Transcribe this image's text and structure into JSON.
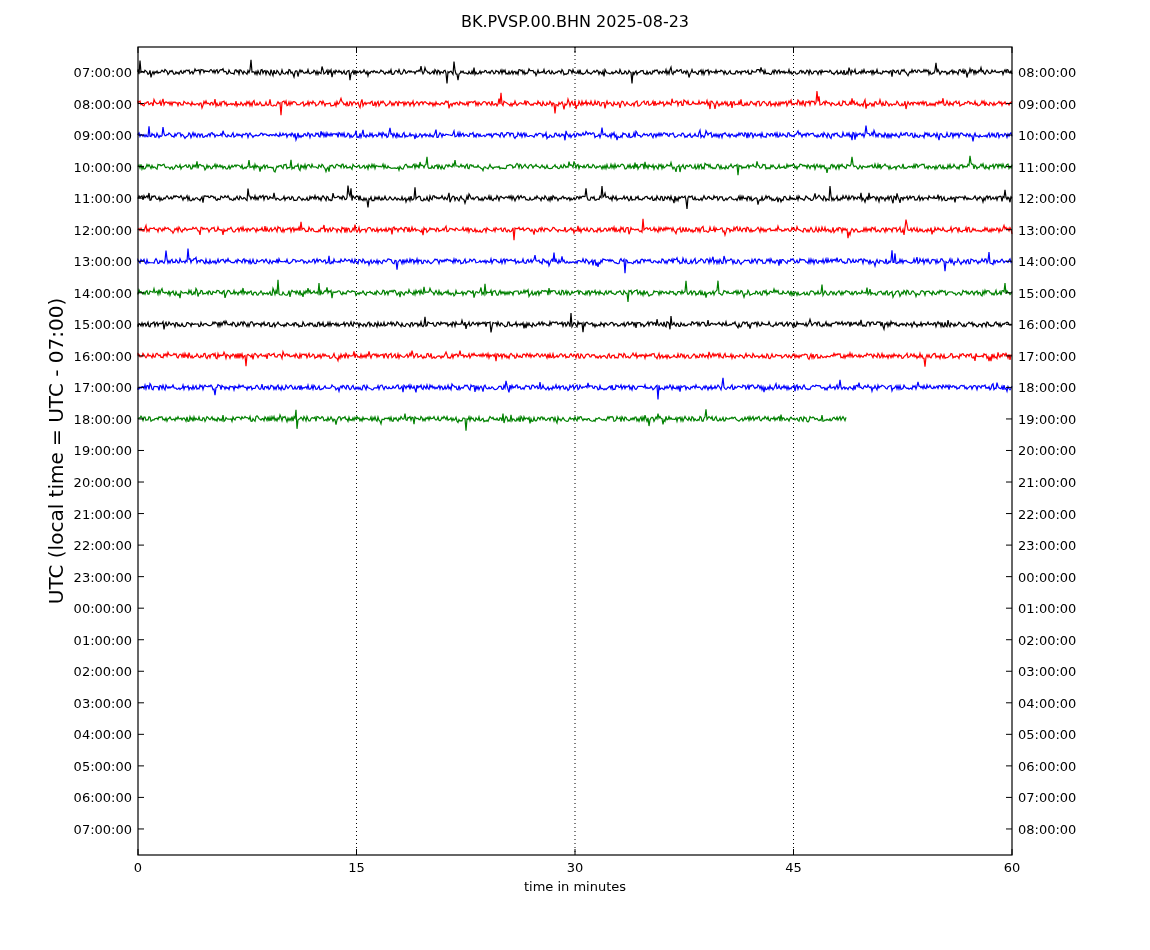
{
  "title": "BK.PVSP.00.BHN 2025-08-23",
  "ylabel": "UTC (local time = UTC - 07:00)",
  "xlabel": "time in minutes",
  "xticks": [
    "0",
    "15",
    "30",
    "45",
    "60"
  ],
  "left_labels": [
    "07:00:00",
    "08:00:00",
    "09:00:00",
    "10:00:00",
    "11:00:00",
    "12:00:00",
    "13:00:00",
    "14:00:00",
    "15:00:00",
    "16:00:00",
    "17:00:00",
    "18:00:00",
    "19:00:00",
    "20:00:00",
    "21:00:00",
    "22:00:00",
    "23:00:00",
    "00:00:00",
    "01:00:00",
    "02:00:00",
    "03:00:00",
    "04:00:00",
    "05:00:00",
    "06:00:00",
    "07:00:00"
  ],
  "right_labels": [
    "08:00:00",
    "09:00:00",
    "10:00:00",
    "11:00:00",
    "12:00:00",
    "13:00:00",
    "14:00:00",
    "15:00:00",
    "16:00:00",
    "17:00:00",
    "18:00:00",
    "19:00:00",
    "20:00:00",
    "21:00:00",
    "22:00:00",
    "23:00:00",
    "00:00:00",
    "01:00:00",
    "02:00:00",
    "03:00:00",
    "04:00:00",
    "05:00:00",
    "06:00:00",
    "07:00:00",
    "08:00:00"
  ],
  "traces": [
    {
      "color": "#000000",
      "level": 1
    },
    {
      "color": "#ff0000",
      "level": 1
    },
    {
      "color": "#0000ff",
      "level": 1
    },
    {
      "color": "#008000",
      "level": 1
    },
    {
      "color": "#000000",
      "level": 1
    },
    {
      "color": "#ff0000",
      "level": 1
    },
    {
      "color": "#0000ff",
      "level": 1
    },
    {
      "color": "#008000",
      "level": 1
    },
    {
      "color": "#000000",
      "level": 1
    },
    {
      "color": "#ff0000",
      "level": 1
    },
    {
      "color": "#0000ff",
      "level": 1
    },
    {
      "color": "#008000",
      "level": 0.81
    }
  ]
}
